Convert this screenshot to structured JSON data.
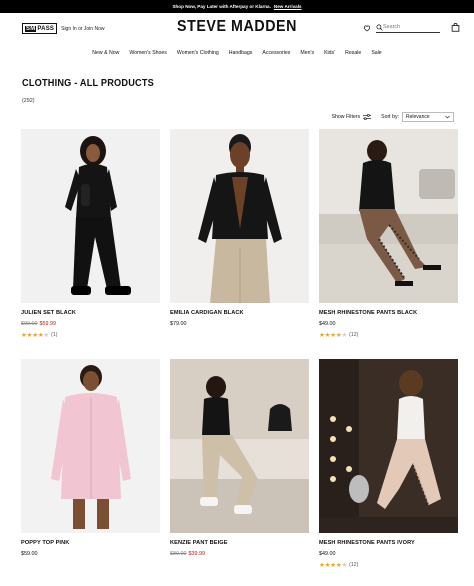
{
  "promo": {
    "text": "Shop Now, Pay Later with Afterpay or Klarna.",
    "link": "New Arrivals"
  },
  "header": {
    "smpass_sm": "SM",
    "smpass_pass": "PASS",
    "signin": "Sign In or Join Now",
    "brand": "STEVE MADDEN",
    "search_placeholder": "Search"
  },
  "nav": [
    "New & Now",
    "Women's Shoes",
    "Women's Clothing",
    "Handbags",
    "Accessories",
    "Men's",
    "Kids'",
    "Resale",
    "Sale"
  ],
  "page": {
    "title": "CLOTHING - ALL PRODUCTS",
    "count": "(292)"
  },
  "toolbar": {
    "filters": "Show Filters",
    "sort_label": "Sort by:",
    "sort_value": "Relevance"
  },
  "products": [
    {
      "name": "JULIEN SET BLACK",
      "old_price": "$99.00",
      "price": "$59.99",
      "rating": 4,
      "reviews": "(1)"
    },
    {
      "name": "EMILIA CARDIGAN BLACK",
      "price": "$79.00"
    },
    {
      "name": "MESH RHINESTONE PANTS BLACK",
      "price": "$49.00",
      "rating": 4,
      "reviews": "(12)"
    },
    {
      "name": "POPPY TOP PINK",
      "price": "$59.00"
    },
    {
      "name": "KENZIE PANT BEIGE",
      "old_price": "$80.00",
      "price": "$39.99"
    },
    {
      "name": "MESH RHINESTONE PANTS IVORY",
      "price": "$49.00",
      "rating": 4,
      "reviews": "(12)"
    }
  ],
  "colors": {
    "sale": "#b21d1d",
    "star": "#e4a62b",
    "promo_bg": "#000000"
  }
}
